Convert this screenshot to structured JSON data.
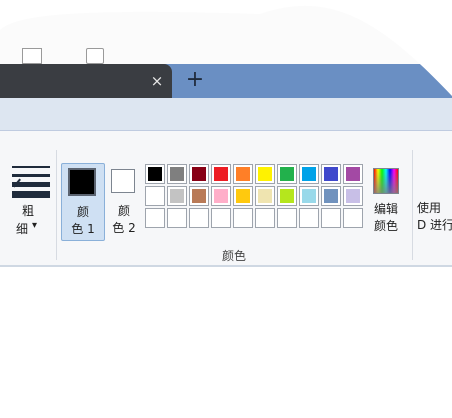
{
  "tabs": {
    "close_glyph": "×",
    "new_tab_glyph": "+"
  },
  "tools": {
    "line_width": {
      "label_line1": "粗",
      "label_line2": "细",
      "dropdown_glyph": "▾"
    },
    "color1": {
      "label_line1": "颜",
      "label_line2": "色 1",
      "color": "#000000"
    },
    "color2": {
      "label_line1": "颜",
      "label_line2": "色 2",
      "color": "#ffffff"
    },
    "edit_colors": {
      "label_line1": "编辑",
      "label_line2": "颜色"
    },
    "use_3d": {
      "label_line1": "使用",
      "label_line2": "D 进行"
    }
  },
  "palette": {
    "row1": [
      "#000000",
      "#7f7f7f",
      "#880015",
      "#ed1c24",
      "#ff7f27",
      "#fff200",
      "#22b14c",
      "#00a2e8",
      "#3f48cc",
      "#a349a4"
    ],
    "row2": [
      "#ffffff",
      "#c3c3c3",
      "#b97a57",
      "#ffaec9",
      "#ffc90e",
      "#efe4b0",
      "#b5e61d",
      "#99d9ea",
      "#7092be",
      "#c8bfe7"
    ],
    "row3_empty_count": 10
  },
  "group_label": "颜色",
  "colors": {
    "tab_strip": "#6a8fc3",
    "active_tab": "#3a3d42",
    "ribbon_bg": "#f6f7f9",
    "selection": "#cfe0f3"
  }
}
